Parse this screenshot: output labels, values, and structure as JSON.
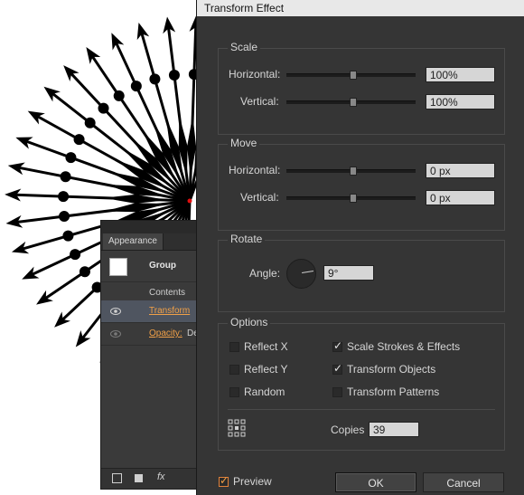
{
  "dialog": {
    "title": "Transform Effect",
    "scale": {
      "legend": "Scale",
      "horizontal_label": "Horizontal:",
      "horizontal_value": "100%",
      "vertical_label": "Vertical:",
      "vertical_value": "100%"
    },
    "move": {
      "legend": "Move",
      "horizontal_label": "Horizontal:",
      "horizontal_value": "0 px",
      "vertical_label": "Vertical:",
      "vertical_value": "0 px"
    },
    "rotate": {
      "legend": "Rotate",
      "angle_label": "Angle:",
      "angle_value": "9°"
    },
    "options": {
      "legend": "Options",
      "reflect_x": "Reflect X",
      "reflect_y": "Reflect Y",
      "random": "Random",
      "scale_strokes": "Scale Strokes & Effects",
      "transform_objects": "Transform Objects",
      "transform_patterns": "Transform Patterns",
      "copies_label": "Copies",
      "copies_value": "39"
    },
    "preview_label": "Preview",
    "ok_label": "OK",
    "cancel_label": "Cancel"
  },
  "appearance": {
    "tab": "Appearance",
    "group_label": "Group",
    "contents_label": "Contents",
    "transform_label": "Transform",
    "opacity_label": "Opacity:",
    "opacity_value": "De",
    "fx_label": "fx"
  },
  "colors": {
    "accent": "#f0a048",
    "dialog_bg": "#353535",
    "field_bg": "#d6d6d6"
  }
}
